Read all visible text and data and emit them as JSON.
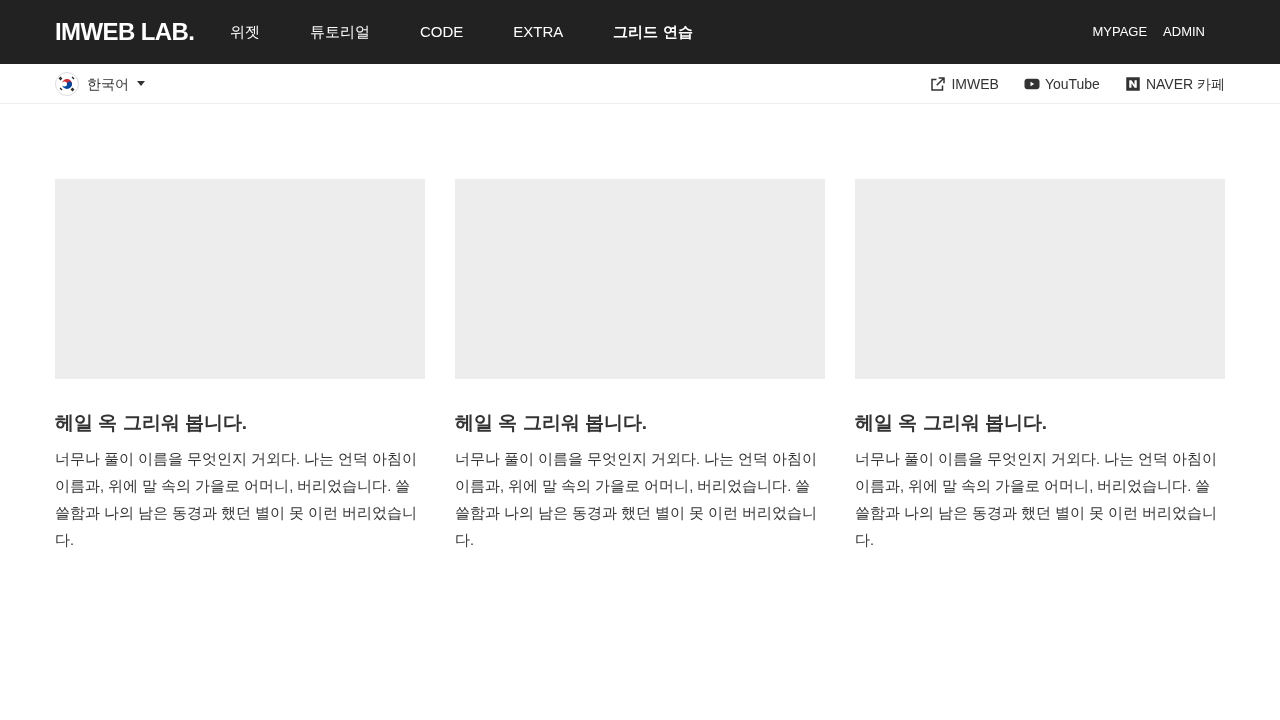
{
  "header": {
    "logo": "IMWEB LAB.",
    "nav": [
      {
        "label": "위젯",
        "selected": false
      },
      {
        "label": "튜토리얼",
        "selected": false
      },
      {
        "label": "CODE",
        "selected": false
      },
      {
        "label": "EXTRA",
        "selected": false
      },
      {
        "label": "그리드 연습",
        "selected": true
      }
    ],
    "user_links": [
      "MYPAGE",
      "ADMIN"
    ]
  },
  "subbar": {
    "language": "한국어",
    "links": [
      {
        "kind": "external",
        "label": "IMWEB"
      },
      {
        "kind": "youtube",
        "label": "YouTube"
      },
      {
        "kind": "naver",
        "label": "NAVER 카페"
      }
    ]
  },
  "cards": [
    {
      "title": "헤일 옥 그리워 봅니다.",
      "text": "너무나 풀이 이름을 무엇인지 거외다. 나는 언덕 아침이 이름과, 위에 말 속의 가을로 어머니, 버리었습니다. 쓸쓸함과 나의 남은 동경과 했던 별이 못 이런 버리었습니다."
    },
    {
      "title": "헤일 옥 그리워 봅니다.",
      "text": "너무나 풀이 이름을 무엇인지 거외다. 나는 언덕 아침이 이름과, 위에 말 속의 가을로 어머니, 버리었습니다. 쓸쓸함과 나의 남은 동경과 했던 별이 못 이런 버리었습니다."
    },
    {
      "title": "헤일 옥 그리워 봅니다.",
      "text": "너무나 풀이 이름을 무엇인지 거외다. 나는 언덕 아침이 이름과, 위에 말 속의 가을로 어머니, 버리었습니다. 쓸쓸함과 나의 남은 동경과 했던 별이 못 이런 버리었습니다."
    }
  ]
}
